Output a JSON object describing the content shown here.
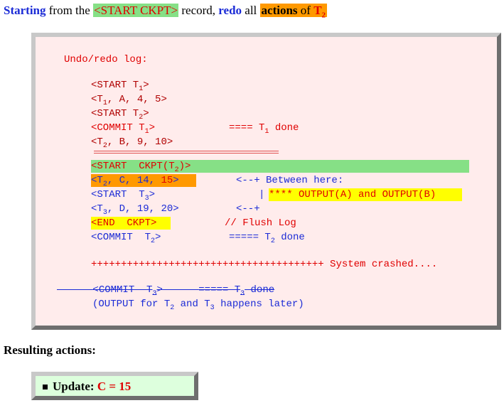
{
  "heading": {
    "part1": "Starting",
    "part2": " from the ",
    "part3": "<START CKPT>",
    "part4": " record, ",
    "part5": "redo",
    "part6": " all ",
    "part7": "actions",
    "part8": " of ",
    "part9": "T",
    "part9_sub": "2"
  },
  "log": {
    "title": "Undo/redo log:",
    "l1": "<START T",
    "l1_sub": "1",
    "l1_end": ">",
    "l2a": "<T",
    "l2_sub": "1",
    "l2b": ", A, 4, 5>",
    "l3": "<START T",
    "l3_sub": "2",
    "l3_end": ">",
    "l4": "<COMMIT T",
    "l4_sub": "1",
    "l4_end": ">",
    "l4_note": "==== T",
    "l4_note_sub": "1",
    "l4_note_end": " done",
    "l5a": "<T",
    "l5_sub": "2",
    "l5b": ", B, 9, 10>",
    "l6": "<START  CKPT(T",
    "l6_sub": "2",
    "l6_end": ")>",
    "l7a": "<T",
    "l7_sub": "2",
    "l7b": ", C, 14, ",
    "l7c": "15",
    "l7d": ">",
    "l7_note": "<--+ Between here:",
    "l8": "<START  T",
    "l8_sub": "3",
    "l8_end": ">",
    "l8_bar": "|",
    "l8_note_stars": "****",
    "l8_note": " OUTPUT(A) and OUTPUT(B)",
    "l9a": "<T",
    "l9_sub": "3",
    "l9b": ", D, 19, 20>",
    "l9_note": "<--+",
    "l10": "<END  CKPT>",
    "l10_note": "// Flush Log",
    "l11": "<COMMIT  T",
    "l11_sub": "2",
    "l11_end": ">",
    "l11_note": "===== T",
    "l11_note_sub": "2",
    "l11_note_end": " done",
    "l12": "+++++++++++++++++++++++++++++++++++++++ System crashed....",
    "l13": "<COMMIT  T",
    "l13_sub": "3",
    "l13_end": ">",
    "l13_note": "===== T",
    "l13_note_sub": "3",
    "l13_note_end": " done",
    "l14a": "(OUTPUT for T",
    "l14_sub1": "2",
    "l14b": " and T",
    "l14_sub2": "3",
    "l14c": " happens later)"
  },
  "results": {
    "title": "Resulting actions:",
    "label": "Update:",
    "value": "C = 15"
  },
  "colors": {
    "blue": "#1a2ad6",
    "red": "#e00000",
    "dark_red": "#b00000",
    "green_highlight": "#86e086",
    "orange_highlight": "#ff9900",
    "yellow_highlight": "#ffff00",
    "log_background": "#ffecec",
    "result_background": "#ddffdd"
  }
}
